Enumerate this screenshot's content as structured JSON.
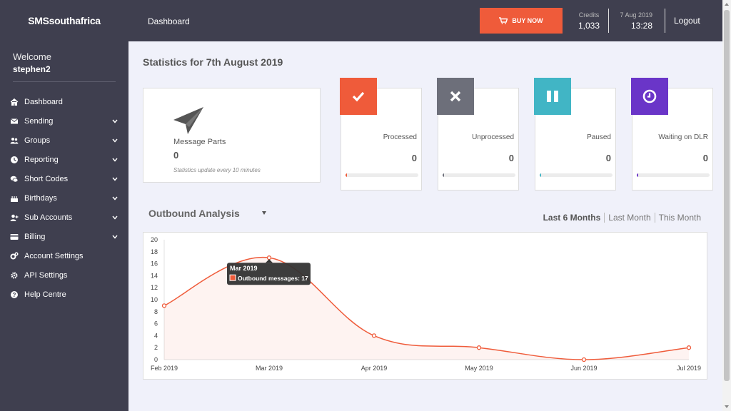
{
  "brand": "SMSsouthafrica",
  "welcome": {
    "greeting": "Welcome",
    "username": "stephen2"
  },
  "nav": [
    {
      "label": "Dashboard",
      "icon": "home-icon",
      "has_submenu": false
    },
    {
      "label": "Sending",
      "icon": "envelope-icon",
      "has_submenu": true
    },
    {
      "label": "Groups",
      "icon": "users-icon",
      "has_submenu": true
    },
    {
      "label": "Reporting",
      "icon": "reporting-icon",
      "has_submenu": true
    },
    {
      "label": "Short Codes",
      "icon": "chat-icon",
      "has_submenu": true
    },
    {
      "label": "Birthdays",
      "icon": "cake-icon",
      "has_submenu": true
    },
    {
      "label": "Sub Accounts",
      "icon": "user-plus-icon",
      "has_submenu": true
    },
    {
      "label": "Billing",
      "icon": "credit-card-icon",
      "has_submenu": true
    },
    {
      "label": "Account Settings",
      "icon": "cogs-icon",
      "has_submenu": false
    },
    {
      "label": "API Settings",
      "icon": "api-cog-icon",
      "has_submenu": false
    },
    {
      "label": "Help Centre",
      "icon": "question-icon",
      "has_submenu": false
    }
  ],
  "header": {
    "breadcrumb": "Dashboard",
    "buy_label": "BUY NOW",
    "credits_label": "Credits",
    "credits_value": "1,033",
    "date": "7 Aug 2019",
    "time": "13:28",
    "logout": "Logout"
  },
  "stats": {
    "title": "Statistics for 7th August 2019",
    "message_parts": {
      "label": "Message Parts",
      "value": "0",
      "note": "Statistics update every 10 minutes"
    },
    "cards": [
      {
        "label": "Processed",
        "value": "0",
        "color": "#ef5b3a",
        "icon": "check-icon",
        "progress": 0.02
      },
      {
        "label": "Unprocessed",
        "value": "0",
        "color": "#6d6f7a",
        "icon": "times-icon",
        "progress": 0.02
      },
      {
        "label": "Paused",
        "value": "0",
        "color": "#41b5c5",
        "icon": "pause-icon",
        "progress": 0.02
      },
      {
        "label": "Waiting on DLR",
        "value": "0",
        "color": "#6a35c8",
        "icon": "clock-icon",
        "progress": 0.02
      }
    ]
  },
  "analysis": {
    "title": "Outbound Analysis",
    "tabs": [
      {
        "label": "Last 6 Months",
        "active": true
      },
      {
        "label": "Last Month",
        "active": false
      },
      {
        "label": "This Month",
        "active": false
      }
    ],
    "tooltip": {
      "title": "Mar 2019",
      "text": "Outbound messages: 17",
      "index": 1
    }
  },
  "chart_data": {
    "type": "area",
    "categories": [
      "Feb 2019",
      "Mar 2019",
      "Apr 2019",
      "May 2019",
      "Jun 2019",
      "Jul 2019"
    ],
    "series": [
      {
        "values": [
          9,
          17,
          4,
          2,
          0,
          2
        ],
        "color": "#ef5b3a"
      }
    ],
    "yticks": [
      "0",
      "2",
      "4",
      "6",
      "8",
      "10",
      "12",
      "14",
      "16",
      "18",
      "20"
    ],
    "ylim": [
      0,
      20
    ],
    "grid": false,
    "legend": "none"
  }
}
